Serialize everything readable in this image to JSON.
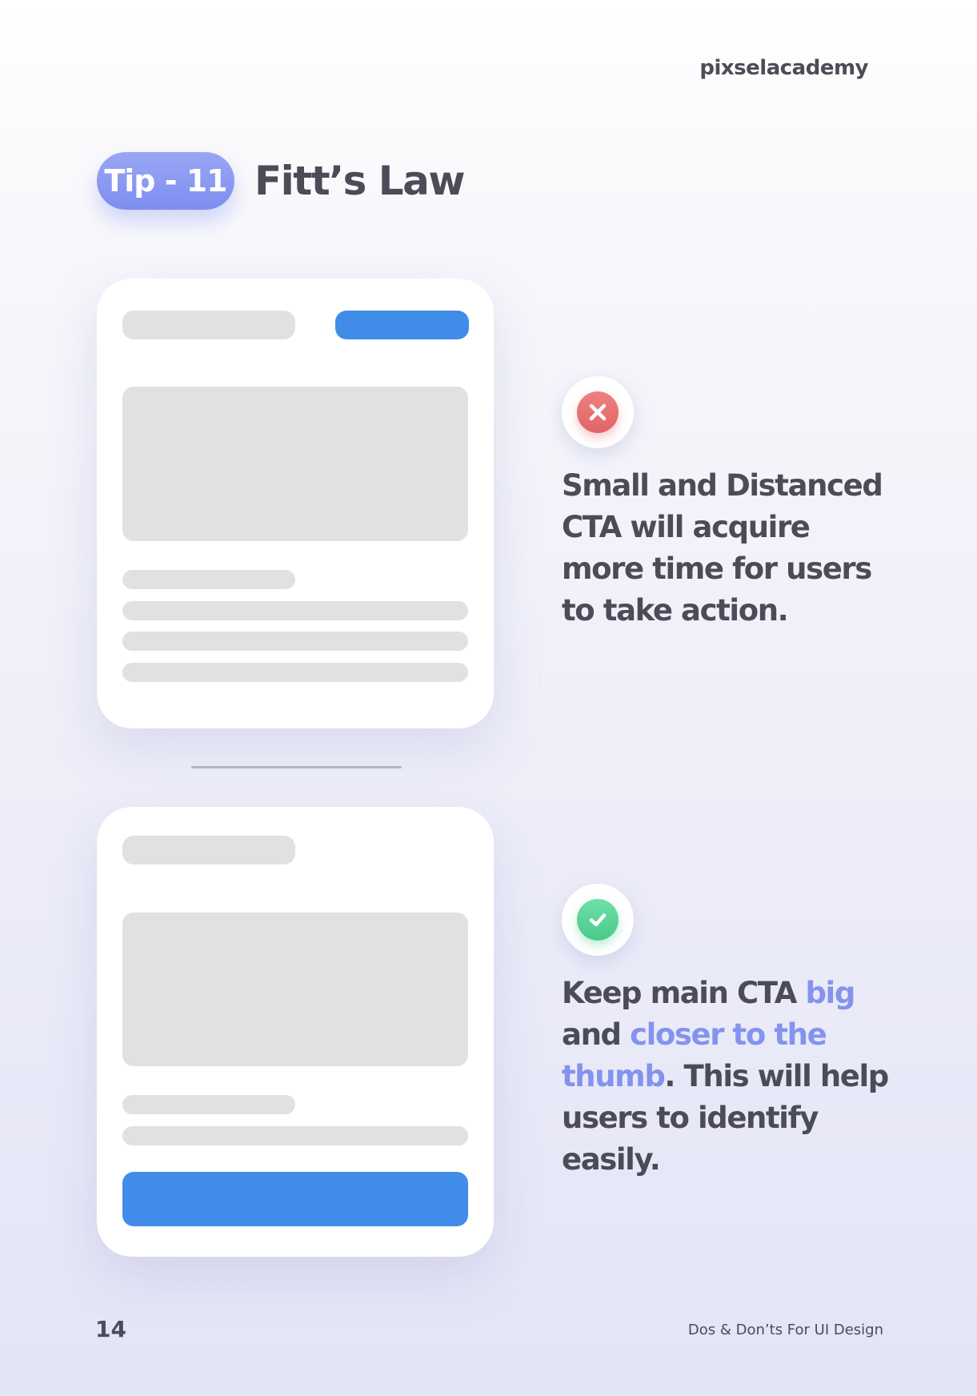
{
  "brand": "pixselacademy",
  "tip": {
    "badge": "Tip - 11",
    "title": "Fitt’s Law"
  },
  "dont": {
    "status_icon": "close-icon",
    "status_color": "#e06565",
    "text": "Small and Distanced CTA will acquire more time for users to take action."
  },
  "do": {
    "status_icon": "check-icon",
    "status_color": "#49c98a",
    "text_parts": {
      "p1": "Keep main CTA ",
      "h1": "big",
      "p2": " and ",
      "h2": "closer to the thumb",
      "p3": ". This will help users to identify easily."
    }
  },
  "colors": {
    "accent": "#8393ee",
    "cta_blue": "#418ce8",
    "placeholder_gray": "#e1e1e1",
    "text_dark": "#4b4c57"
  },
  "footer": {
    "page_number": "14",
    "title": "Dos & Don’ts For UI Design"
  }
}
